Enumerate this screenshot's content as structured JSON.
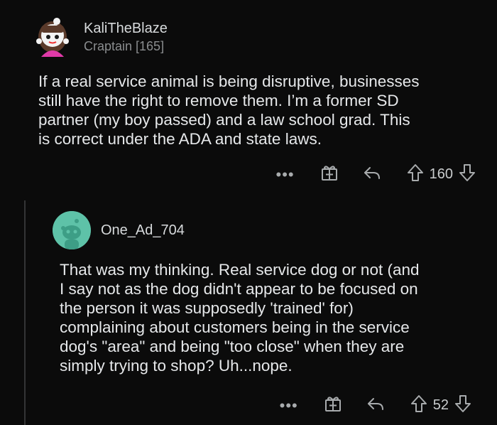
{
  "comments": [
    {
      "username": "KaliTheBlaze",
      "flair": "Craptain [165]",
      "body": "If a real service animal is being disruptive, businesses\nstill have the right to remove them.  I’m a former SD\npartner (my boy passed) and a law school grad.  This\nis correct under the ADA and state laws.",
      "more_label": "•••",
      "score": "160"
    },
    {
      "username": "One_Ad_704",
      "body": "That was my thinking. Real service dog or not (and\nI say not as the dog didn't appear to be focused on\nthe person it was supposedly 'trained' for)\ncomplaining about customers being in the service\ndog's \"area\" and being \"too close\" when they are\nsimply trying to shop? Uh...nope.",
      "more_label": "•••",
      "score": "52"
    }
  ],
  "icons": [
    "snoo-avatar-icon",
    "gift-icon",
    "reply-icon",
    "upvote-icon",
    "downvote-icon"
  ],
  "colors": {
    "background": "#0b0b0b",
    "text": "#d7dadc",
    "muted": "#8a8d8f",
    "avatar2": "#5ec2a8"
  }
}
